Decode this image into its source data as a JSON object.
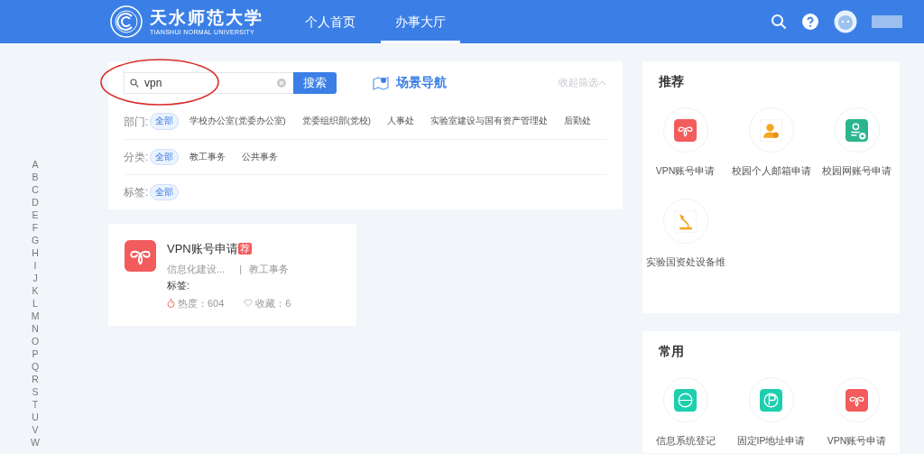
{
  "header": {
    "logo_text": "天水师范大学",
    "logo_subtext": "TIANSHUI NORMAL UNIVERSITY",
    "nav": [
      {
        "label": "个人首页",
        "selected": false
      },
      {
        "label": "办事大厅",
        "selected": true
      }
    ]
  },
  "index_letters": [
    "A",
    "B",
    "C",
    "D",
    "E",
    "F",
    "G",
    "H",
    "I",
    "J",
    "K",
    "L",
    "M",
    "N",
    "O",
    "P",
    "Q",
    "R",
    "S",
    "T",
    "U",
    "V",
    "W"
  ],
  "search": {
    "value": "vpn",
    "button": "搜索",
    "highlighted": true
  },
  "scene_nav": "场景导航",
  "collapse": "收起筛选",
  "filters": [
    {
      "label": "部门:",
      "options": [
        {
          "label": "全部",
          "selected": true
        },
        {
          "label": "学校办公室(党委办公室)",
          "selected": false
        },
        {
          "label": "党委组织部(党校)",
          "selected": false
        },
        {
          "label": "人事处",
          "selected": false
        },
        {
          "label": "实验室建设与国有资产管理处",
          "selected": false
        },
        {
          "label": "后勤处",
          "selected": false
        }
      ]
    },
    {
      "label": "分类:",
      "options": [
        {
          "label": "全部",
          "selected": true
        },
        {
          "label": "教工事务",
          "selected": false
        },
        {
          "label": "公共事务",
          "selected": false
        }
      ]
    },
    {
      "label": "标签:",
      "options": [
        {
          "label": "全部",
          "selected": true
        }
      ]
    }
  ],
  "results": [
    {
      "kind": "vpn",
      "title": "VPN账号申请",
      "badge": "荐",
      "department": "信息化建设...",
      "separator": "|",
      "category": "教工事务",
      "tags_label": "标签:",
      "heat_label": "热度：",
      "heat": "604",
      "fav_label": "收藏：",
      "favorites": "6"
    }
  ],
  "panels": [
    {
      "title": "推荐",
      "items": [
        {
          "kind": "vpn",
          "label": "VPN账号申请"
        },
        {
          "kind": "mail",
          "label": "校园个人邮箱申请"
        },
        {
          "kind": "network",
          "label": "校园网账号申请"
        },
        {
          "kind": "lamp",
          "label": "实验国资处设备维"
        }
      ]
    },
    {
      "title": "常用",
      "items": [
        {
          "kind": "www",
          "label": "信息系统登记"
        },
        {
          "kind": "ip",
          "label": "固定IP地址申请"
        },
        {
          "kind": "vpn",
          "label": "VPN账号申请"
        }
      ]
    }
  ]
}
